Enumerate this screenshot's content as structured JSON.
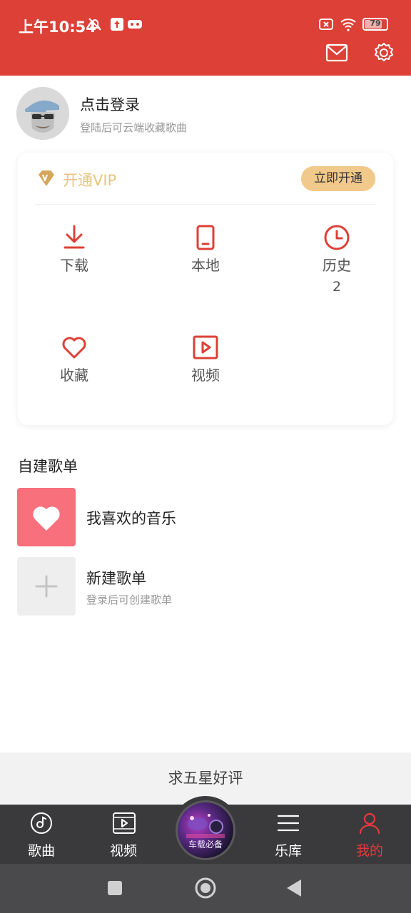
{
  "status_bar": {
    "time": "上午10:54",
    "battery": "79"
  },
  "header": {
    "mail_icon": "mail-icon",
    "settings_icon": "gear-icon",
    "background_color": "#dc4037"
  },
  "profile": {
    "login_title": "点击登录",
    "login_subtitle": "登陆后可云端收藏歌曲"
  },
  "vip": {
    "label": "开通VIP",
    "button": "立即开通",
    "accent_color": "#e9c47f"
  },
  "grid": [
    {
      "label": "下载",
      "icon": "download-icon"
    },
    {
      "label": "本地",
      "icon": "phone-icon"
    },
    {
      "label": "历史",
      "icon": "clock-icon",
      "count": "2"
    },
    {
      "label": "收藏",
      "icon": "heart-icon"
    },
    {
      "label": "视频",
      "icon": "video-play-icon"
    }
  ],
  "playlists": {
    "section_title": "自建歌单",
    "items": [
      {
        "title": "我喜欢的音乐",
        "subtitle": ""
      },
      {
        "title": "新建歌单",
        "subtitle": "登录后可创建歌单"
      }
    ]
  },
  "rate_prompt": "求五星好评",
  "bottom_nav": [
    {
      "label": "歌曲",
      "icon": "music-disc-icon",
      "active": false
    },
    {
      "label": "视频",
      "icon": "video-icon",
      "active": false
    },
    {
      "label": "",
      "icon": "now-playing-disc",
      "active": false
    },
    {
      "label": "乐库",
      "icon": "menu-lines-icon",
      "active": false
    },
    {
      "label": "我的",
      "icon": "user-icon",
      "active": true
    }
  ],
  "now_playing_text": "车载必备",
  "active_color": "#e8393d"
}
